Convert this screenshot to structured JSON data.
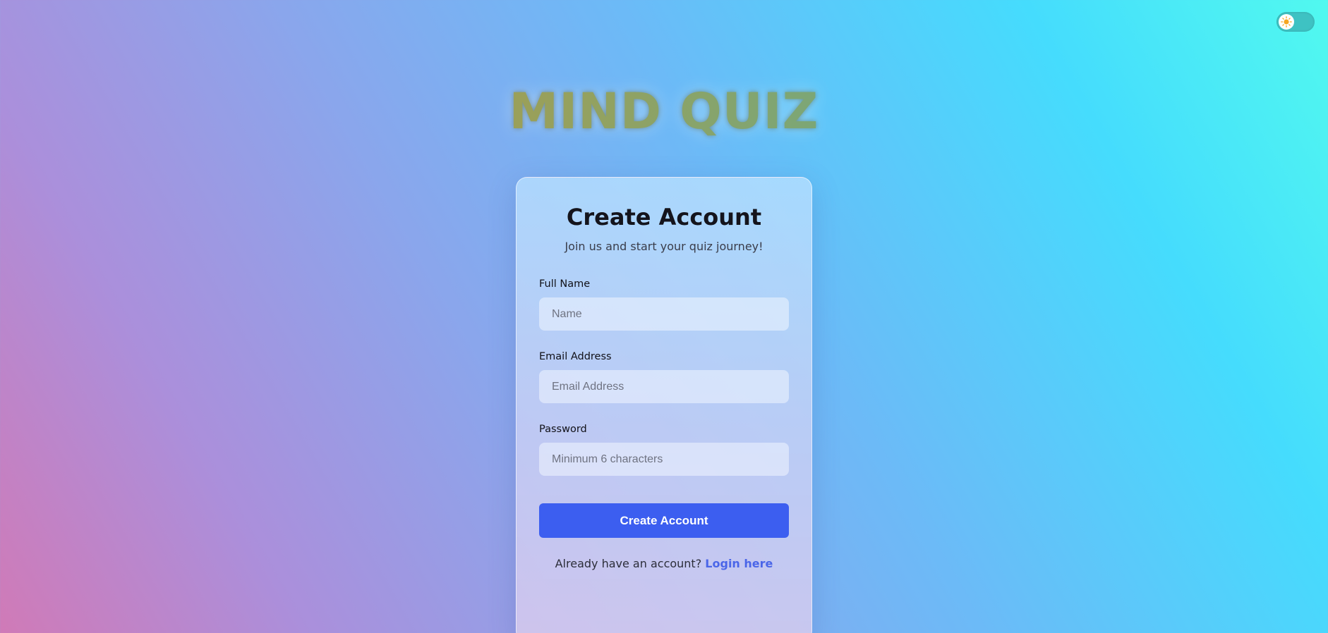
{
  "theme_toggle": {
    "icon": "sun-icon",
    "state": "light"
  },
  "app": {
    "title": "MIND QUIZ"
  },
  "card": {
    "title": "Create Account",
    "subtitle": "Join us and start your quiz journey!"
  },
  "form": {
    "fields": [
      {
        "label": "Full Name",
        "placeholder": "Name",
        "value": ""
      },
      {
        "label": "Email Address",
        "placeholder": "Email Address",
        "value": ""
      },
      {
        "label": "Password",
        "placeholder": "Minimum 6 characters",
        "value": ""
      }
    ],
    "submit_label": "Create Account"
  },
  "login": {
    "prompt": "Already have an account?",
    "link_label": "Login here"
  },
  "colors": {
    "primary_button": "#3c5ef0",
    "link": "#4b66e8",
    "toggle_track": "#3ec2c3",
    "sun": "#f5a623"
  }
}
